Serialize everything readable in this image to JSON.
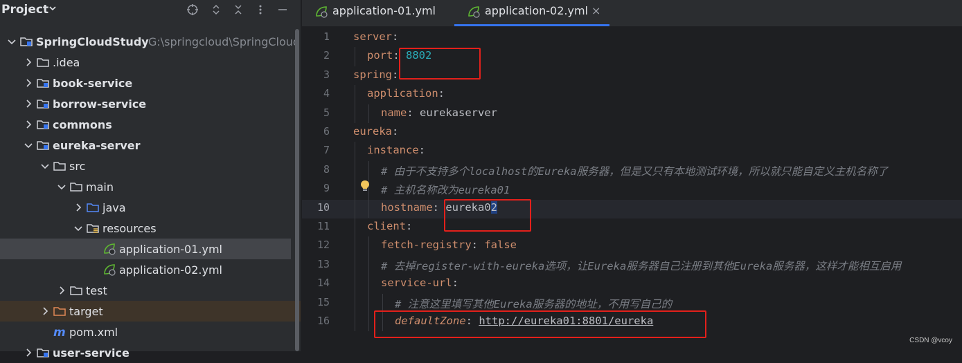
{
  "project_panel": {
    "title": "Project",
    "tree": [
      {
        "label": "SpringCloudStudy",
        "path": "G:\\springcloud\\SpringCloudS",
        "bold": true,
        "icon": "module-folder-icon",
        "expanded": true,
        "indent": 0
      },
      {
        "label": ".idea",
        "icon": "folder-icon",
        "expanded": false,
        "indent": 1
      },
      {
        "label": "book-service",
        "bold": true,
        "icon": "module-folder-icon",
        "expanded": false,
        "indent": 1
      },
      {
        "label": "borrow-service",
        "bold": true,
        "icon": "module-folder-icon",
        "expanded": false,
        "indent": 1
      },
      {
        "label": "commons",
        "bold": true,
        "icon": "module-folder-icon",
        "expanded": false,
        "indent": 1
      },
      {
        "label": "eureka-server",
        "bold": true,
        "icon": "module-folder-icon",
        "expanded": true,
        "indent": 1
      },
      {
        "label": "src",
        "icon": "folder-icon",
        "expanded": true,
        "indent": 2
      },
      {
        "label": "main",
        "icon": "folder-icon",
        "expanded": true,
        "indent": 3
      },
      {
        "label": "java",
        "icon": "source-folder-icon",
        "expanded": false,
        "indent": 4
      },
      {
        "label": "resources",
        "icon": "resources-folder-icon",
        "expanded": true,
        "indent": 4
      },
      {
        "label": "application-01.yml",
        "icon": "spring-yml-icon",
        "indent": 5,
        "selected": true
      },
      {
        "label": "application-02.yml",
        "icon": "spring-yml-icon",
        "indent": 5
      },
      {
        "label": "test",
        "icon": "folder-icon",
        "expanded": false,
        "indent": 3
      },
      {
        "label": "target",
        "icon": "excluded-folder-icon",
        "expanded": false,
        "indent": 2,
        "excluded": true
      },
      {
        "label": "pom.xml",
        "icon": "maven-icon",
        "indent": 2
      },
      {
        "label": "user-service",
        "bold": true,
        "icon": "module-folder-icon",
        "expanded": false,
        "indent": 1
      }
    ]
  },
  "tabs": [
    {
      "label": "application-01.yml",
      "active": false
    },
    {
      "label": "application-02.yml",
      "active": true,
      "close": "×"
    }
  ],
  "editor": {
    "current_line": 10,
    "lines": [
      {
        "n": "1",
        "indent": 0,
        "segs": [
          [
            "k",
            "server"
          ],
          [
            "p",
            ":"
          ]
        ]
      },
      {
        "n": "2",
        "indent": 1,
        "segs": [
          [
            "k",
            "port"
          ],
          [
            "p",
            ": "
          ],
          [
            "num",
            "8802"
          ]
        ]
      },
      {
        "n": "3",
        "indent": 0,
        "segs": [
          [
            "k",
            "spring"
          ],
          [
            "p",
            ":"
          ]
        ]
      },
      {
        "n": "4",
        "indent": 1,
        "segs": [
          [
            "k",
            "application"
          ],
          [
            "p",
            ":"
          ]
        ]
      },
      {
        "n": "5",
        "indent": 2,
        "segs": [
          [
            "k",
            "name"
          ],
          [
            "p",
            ": "
          ],
          [
            "v",
            "eurekaserver"
          ]
        ]
      },
      {
        "n": "6",
        "indent": 0,
        "segs": [
          [
            "k",
            "eureka"
          ],
          [
            "p",
            ":"
          ]
        ]
      },
      {
        "n": "7",
        "indent": 1,
        "segs": [
          [
            "k",
            "instance"
          ],
          [
            "p",
            ":"
          ]
        ]
      },
      {
        "n": "8",
        "indent": 2,
        "segs": [
          [
            "cm",
            "# 由于不支持多个localhost的Eureka服务器，但是又只有本地测试环境，所以就只能自定义主机名称了"
          ]
        ]
      },
      {
        "n": "9",
        "indent": 2,
        "segs": [
          [
            "cm",
            "# 主机名称改为eureka01"
          ]
        ]
      },
      {
        "n": "10",
        "indent": 2,
        "segs": [
          [
            "k",
            "hostname"
          ],
          [
            "p",
            ": "
          ],
          [
            "v",
            "eureka0"
          ],
          [
            "sel",
            "2"
          ]
        ]
      },
      {
        "n": "11",
        "indent": 1,
        "segs": [
          [
            "k",
            "client"
          ],
          [
            "p",
            ":"
          ]
        ]
      },
      {
        "n": "12",
        "indent": 2,
        "segs": [
          [
            "k",
            "fetch-registry"
          ],
          [
            "p",
            ": "
          ],
          [
            "kw",
            "false"
          ]
        ]
      },
      {
        "n": "13",
        "indent": 2,
        "segs": [
          [
            "cm",
            "# 去掉register-with-eureka选项，让Eureka服务器自己注册到其他Eureka服务器，这样才能相互启用"
          ]
        ]
      },
      {
        "n": "14",
        "indent": 2,
        "segs": [
          [
            "k",
            "service-url"
          ],
          [
            "p",
            ":"
          ]
        ]
      },
      {
        "n": "15",
        "indent": 3,
        "segs": [
          [
            "cm",
            "# 注意这里填写其他Eureka服务器的地址，不用写自己的"
          ]
        ]
      },
      {
        "n": "16",
        "indent": 3,
        "segs": [
          [
            "k it",
            "defaultZone"
          ],
          [
            "p",
            ": "
          ],
          [
            "url",
            "http://eureka01:8801/eureka"
          ]
        ]
      }
    ]
  },
  "watermark": "CSDN @vcoy",
  "colors": {
    "accent": "#3574f0",
    "highlight_box": "#e3201b",
    "key": "#cf8e6d",
    "number": "#2aacb8",
    "comment": "#7a7e85"
  }
}
